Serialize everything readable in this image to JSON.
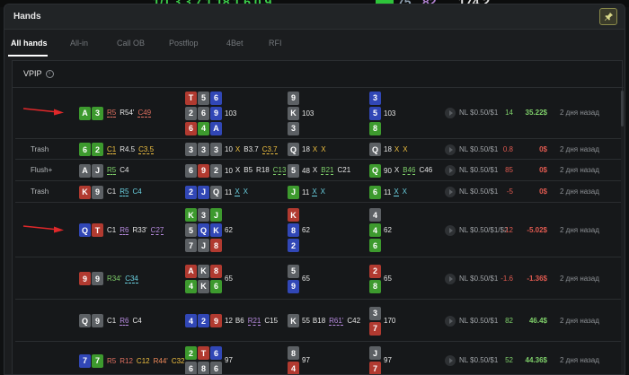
{
  "window": {
    "title": "Hands",
    "accent": "#8a8a4a",
    "pin_icon": "pin-icon"
  },
  "background_fragments": [
    "1/1 3 3 7 1 18 1 6 0 9",
    "75",
    "82",
    "174.2"
  ],
  "tabs": [
    {
      "label": "All hands",
      "active": true
    },
    {
      "label": "All-in",
      "active": false
    },
    {
      "label": "Call OB",
      "active": false
    },
    {
      "label": "Postflop",
      "active": false
    },
    {
      "label": "4Bet",
      "active": false
    },
    {
      "label": "RFI",
      "active": false
    }
  ],
  "panel": {
    "header": "VPIP",
    "info_icon": "info-icon"
  },
  "colors": {
    "spade": "#5c6064",
    "heart": "#b13a30",
    "diamond": "#3147b6",
    "club": "#3d9a2e",
    "positive": "#7fd06a",
    "negative": "#e05a50"
  },
  "rows": [
    {
      "label": "",
      "arrow": true,
      "hero": [
        {
          "r": "A",
          "s": "c"
        },
        {
          "r": "3",
          "s": "c"
        }
      ],
      "preflop": [
        {
          "t": "R5",
          "c": "r",
          "u": true
        },
        {
          "t": "R54'",
          "c": "w",
          "u": false
        },
        {
          "t": "C49",
          "c": "r",
          "u": true
        }
      ],
      "flop": {
        "lines": [
          [
            {
              "r": "T",
              "s": "h"
            },
            {
              "r": "5",
              "s": "s"
            },
            {
              "r": "6",
              "s": "d"
            }
          ],
          [
            {
              "r": "2",
              "s": "s"
            },
            {
              "r": "6",
              "s": "s"
            },
            {
              "r": "9",
              "s": "d"
            }
          ],
          [
            {
              "r": "6",
              "s": "h"
            },
            {
              "r": "4",
              "s": "c"
            },
            {
              "r": "A",
              "s": "d"
            }
          ]
        ],
        "pot": "103",
        "actions": []
      },
      "turn": {
        "lines": [
          [
            {
              "r": "9",
              "s": "s"
            }
          ],
          [
            {
              "r": "K",
              "s": "s"
            }
          ],
          [
            {
              "r": "3",
              "s": "s"
            }
          ]
        ],
        "pot": "103",
        "actions": []
      },
      "river": {
        "lines": [
          [
            {
              "r": "3",
              "s": "d"
            }
          ],
          [
            {
              "r": "5",
              "s": "d"
            }
          ],
          [
            {
              "r": "8",
              "s": "c"
            }
          ]
        ],
        "pot": "103",
        "actions": []
      },
      "game": "NL $0.50/$1",
      "bb": "14",
      "money": "35.22$",
      "result": "pos",
      "time": "2 дня назад"
    },
    {
      "label": "Trash",
      "arrow": false,
      "hero": [
        {
          "r": "6",
          "s": "c"
        },
        {
          "r": "2",
          "s": "c"
        }
      ],
      "preflop": [
        {
          "t": "C1",
          "c": "y",
          "u": true
        },
        {
          "t": "R4.5",
          "c": "w",
          "u": false
        },
        {
          "t": "C3.5",
          "c": "y",
          "u": true
        }
      ],
      "flop": {
        "lines": [
          [
            {
              "r": "3",
              "s": "s"
            },
            {
              "r": "3",
              "s": "s"
            },
            {
              "r": "3",
              "s": "s"
            }
          ]
        ],
        "pot": "10",
        "actions": [
          {
            "t": "X",
            "c": "y",
            "u": false
          },
          {
            "t": "B3.7",
            "c": "w",
            "u": false
          },
          {
            "t": "C3.7",
            "c": "y",
            "u": true
          }
        ]
      },
      "turn": {
        "lines": [
          [
            {
              "r": "Q",
              "s": "s"
            }
          ]
        ],
        "pot": "18",
        "actions": [
          {
            "t": "X",
            "c": "y",
            "u": false
          },
          {
            "t": "X",
            "c": "y",
            "u": false
          }
        ]
      },
      "river": {
        "lines": [
          [
            {
              "r": "Q",
              "s": "s"
            }
          ]
        ],
        "pot": "18",
        "actions": [
          {
            "t": "X",
            "c": "y",
            "u": false
          },
          {
            "t": "X",
            "c": "y",
            "u": false
          }
        ]
      },
      "game": "NL $0.50/$1",
      "bb": "0.8",
      "money": "0$",
      "result": "neg",
      "time": "2 дня назад"
    },
    {
      "label": "Flush+",
      "arrow": false,
      "hero": [
        {
          "r": "A",
          "s": "s"
        },
        {
          "r": "J",
          "s": "s"
        }
      ],
      "preflop": [
        {
          "t": "R5",
          "c": "g",
          "u": true
        },
        {
          "t": "C4",
          "c": "w",
          "u": false
        }
      ],
      "flop": {
        "lines": [
          [
            {
              "r": "6",
              "s": "s"
            },
            {
              "r": "9",
              "s": "h"
            },
            {
              "r": "2",
              "s": "s"
            }
          ]
        ],
        "pot": "10",
        "actions": [
          {
            "t": "X",
            "c": "w",
            "u": false
          },
          {
            "t": "B5",
            "c": "w",
            "u": false
          },
          {
            "t": "R18",
            "c": "w",
            "u": false
          },
          {
            "t": "C13",
            "c": "g",
            "u": true
          }
        ]
      },
      "turn": {
        "lines": [
          [
            {
              "r": "5",
              "s": "s"
            }
          ]
        ],
        "pot": "48",
        "actions": [
          {
            "t": "X",
            "c": "w",
            "u": false
          },
          {
            "t": "B21",
            "c": "g",
            "u": true
          },
          {
            "t": "C21",
            "c": "w",
            "u": false
          }
        ]
      },
      "river": {
        "lines": [
          [
            {
              "r": "Q",
              "s": "c"
            }
          ]
        ],
        "pot": "90",
        "actions": [
          {
            "t": "X",
            "c": "w",
            "u": false
          },
          {
            "t": "B46",
            "c": "g",
            "u": true
          },
          {
            "t": "C46",
            "c": "w",
            "u": false
          }
        ]
      },
      "game": "NL $0.50/$1",
      "bb": "85",
      "money": "0$",
      "result": "neg",
      "time": "2 дня назад"
    },
    {
      "label": "Trash",
      "arrow": false,
      "hero": [
        {
          "r": "K",
          "s": "h"
        },
        {
          "r": "9",
          "s": "s"
        }
      ],
      "preflop": [
        {
          "t": "C1",
          "c": "w",
          "u": false
        },
        {
          "t": "R5",
          "c": "c",
          "u": true
        },
        {
          "t": "C4",
          "c": "c",
          "u": false
        }
      ],
      "flop": {
        "lines": [
          [
            {
              "r": "2",
              "s": "d"
            },
            {
              "r": "J",
              "s": "d"
            },
            {
              "r": "Q",
              "s": "s"
            }
          ]
        ],
        "pot": "11",
        "actions": [
          {
            "t": "X",
            "c": "c",
            "u": true
          },
          {
            "t": "X",
            "c": "c",
            "u": false
          }
        ]
      },
      "turn": {
        "lines": [
          [
            {
              "r": "J",
              "s": "c"
            }
          ]
        ],
        "pot": "11",
        "actions": [
          {
            "t": "X",
            "c": "c",
            "u": true
          },
          {
            "t": "X",
            "c": "c",
            "u": false
          }
        ]
      },
      "river": {
        "lines": [
          [
            {
              "r": "6",
              "s": "c"
            }
          ]
        ],
        "pot": "11",
        "actions": [
          {
            "t": "X",
            "c": "c",
            "u": true
          },
          {
            "t": "X",
            "c": "c",
            "u": false
          }
        ]
      },
      "game": "NL $0.50/$1",
      "bb": "-5",
      "money": "0$",
      "result": "neg",
      "time": "2 дня назад"
    },
    {
      "label": "",
      "arrow": true,
      "hero": [
        {
          "r": "Q",
          "s": "d"
        },
        {
          "r": "T",
          "s": "h"
        }
      ],
      "preflop": [
        {
          "t": "C1",
          "c": "w",
          "u": false
        },
        {
          "t": "R6",
          "c": "p",
          "u": true
        },
        {
          "t": "R33'",
          "c": "w",
          "u": false
        },
        {
          "t": "C27",
          "c": "p",
          "u": true
        }
      ],
      "flop": {
        "lines": [
          [
            {
              "r": "K",
              "s": "c"
            },
            {
              "r": "3",
              "s": "s"
            },
            {
              "r": "J",
              "s": "c"
            }
          ],
          [
            {
              "r": "5",
              "s": "s"
            },
            {
              "r": "Q",
              "s": "d"
            },
            {
              "r": "K",
              "s": "d"
            }
          ],
          [
            {
              "r": "7",
              "s": "s"
            },
            {
              "r": "J",
              "s": "s"
            },
            {
              "r": "8",
              "s": "h"
            }
          ]
        ],
        "pot": "62",
        "actions": []
      },
      "turn": {
        "lines": [
          [
            {
              "r": "K",
              "s": "h"
            }
          ],
          [
            {
              "r": "8",
              "s": "d"
            }
          ],
          [
            {
              "r": "2",
              "s": "d"
            }
          ]
        ],
        "pot": "62",
        "actions": []
      },
      "river": {
        "lines": [
          [
            {
              "r": "4",
              "s": "s"
            }
          ],
          [
            {
              "r": "4",
              "s": "c"
            }
          ],
          [
            {
              "r": "6",
              "s": "c"
            }
          ]
        ],
        "pot": "62",
        "actions": []
      },
      "game": "NL $0.50/$1/$2",
      "bb": "-12",
      "money": "-5.02$",
      "result": "neg",
      "time": "2 дня назад"
    },
    {
      "label": "",
      "arrow": false,
      "hero": [
        {
          "r": "9",
          "s": "h"
        },
        {
          "r": "9",
          "s": "s"
        }
      ],
      "preflop": [
        {
          "t": "R34'",
          "c": "g",
          "u": false
        },
        {
          "t": "C34",
          "c": "c",
          "u": true
        }
      ],
      "flop": {
        "lines": [
          [
            {
              "r": "A",
              "s": "h"
            },
            {
              "r": "K",
              "s": "s"
            },
            {
              "r": "8",
              "s": "h"
            }
          ],
          [
            {
              "r": "4",
              "s": "c"
            },
            {
              "r": "K",
              "s": "s"
            },
            {
              "r": "6",
              "s": "c"
            }
          ]
        ],
        "pot": "65",
        "actions": []
      },
      "turn": {
        "lines": [
          [
            {
              "r": "5",
              "s": "s"
            }
          ],
          [
            {
              "r": "9",
              "s": "d"
            }
          ]
        ],
        "pot": "65",
        "actions": []
      },
      "river": {
        "lines": [
          [
            {
              "r": "2",
              "s": "h"
            }
          ],
          [
            {
              "r": "8",
              "s": "c"
            }
          ]
        ],
        "pot": "65",
        "actions": []
      },
      "game": "NL $0.50/$1",
      "bb": "-1.6",
      "money": "-1.36$",
      "result": "neg",
      "time": "2 дня назад"
    },
    {
      "label": "",
      "arrow": false,
      "hero": [
        {
          "r": "Q",
          "s": "s"
        },
        {
          "r": "9",
          "s": "s"
        }
      ],
      "preflop": [
        {
          "t": "C1",
          "c": "w",
          "u": false
        },
        {
          "t": "R6",
          "c": "p",
          "u": true
        },
        {
          "t": "C4",
          "c": "w",
          "u": false
        }
      ],
      "flop": {
        "lines": [
          [
            {
              "r": "4",
              "s": "d"
            },
            {
              "r": "2",
              "s": "d"
            },
            {
              "r": "9",
              "s": "h"
            }
          ]
        ],
        "pot": "12",
        "actions": [
          {
            "t": "B6",
            "c": "w",
            "u": false
          },
          {
            "t": "R21",
            "c": "p",
            "u": true
          },
          {
            "t": "C15",
            "c": "w",
            "u": false
          }
        ]
      },
      "turn": {
        "lines": [
          [
            {
              "r": "K",
              "s": "s"
            }
          ]
        ],
        "pot": "55",
        "actions": [
          {
            "t": "B18",
            "c": "w",
            "u": false
          },
          {
            "t": "R61'",
            "c": "p",
            "u": true
          },
          {
            "t": "C42",
            "c": "w",
            "u": false
          }
        ]
      },
      "river": {
        "lines": [
          [
            {
              "r": "3",
              "s": "s"
            }
          ],
          [
            {
              "r": "7",
              "s": "h"
            }
          ]
        ],
        "pot": "170",
        "actions": []
      },
      "game": "NL $0.50/$1",
      "bb": "82",
      "money": "46.4$",
      "result": "pos",
      "time": "2 дня назад"
    },
    {
      "label": "",
      "arrow": false,
      "hero": [
        {
          "r": "7",
          "s": "d"
        },
        {
          "r": "7",
          "s": "c"
        }
      ],
      "preflop": [
        {
          "t": "R5",
          "c": "r",
          "u": false
        },
        {
          "t": "R12",
          "c": "r",
          "u": false
        },
        {
          "t": "C12",
          "c": "y",
          "u": false
        },
        {
          "t": "R44'",
          "c": "o",
          "u": false
        },
        {
          "t": "C32",
          "c": "y",
          "u": false
        }
      ],
      "flop": {
        "lines": [
          [
            {
              "r": "2",
              "s": "c"
            },
            {
              "r": "T",
              "s": "h"
            },
            {
              "r": "6",
              "s": "d"
            }
          ],
          [
            {
              "r": "6",
              "s": "s"
            },
            {
              "r": "8",
              "s": "s"
            },
            {
              "r": "6",
              "s": "s"
            }
          ]
        ],
        "pot": "97",
        "actions": []
      },
      "turn": {
        "lines": [
          [
            {
              "r": "8",
              "s": "s"
            }
          ],
          [
            {
              "r": "4",
              "s": "h"
            }
          ]
        ],
        "pot": "97",
        "actions": []
      },
      "river": {
        "lines": [
          [
            {
              "r": "J",
              "s": "s"
            }
          ],
          [
            {
              "r": "7",
              "s": "h"
            }
          ]
        ],
        "pot": "97",
        "actions": []
      },
      "game": "NL $0.50/$1",
      "bb": "52",
      "money": "44.36$",
      "result": "pos",
      "time": "2 дня назад"
    }
  ]
}
